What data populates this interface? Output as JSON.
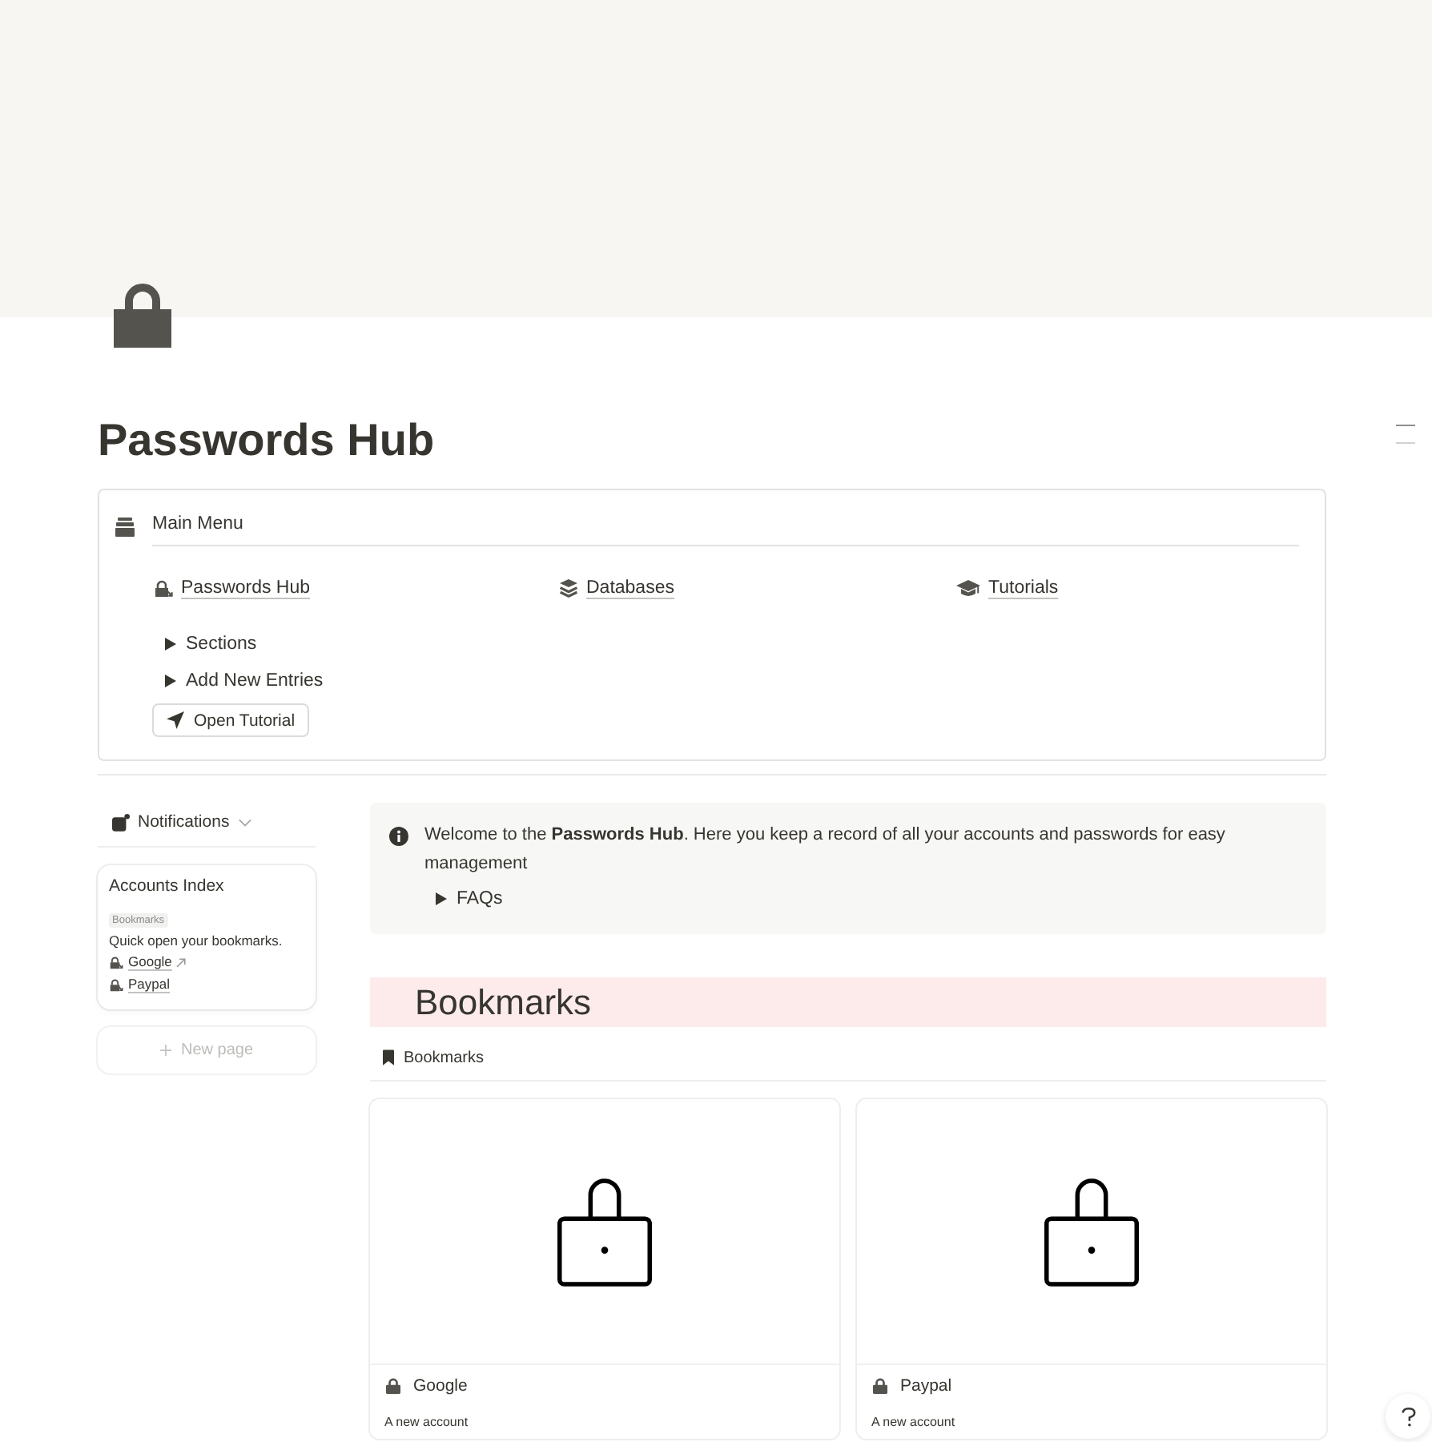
{
  "page": {
    "title": "Passwords Hub"
  },
  "main_menu": {
    "title": "Main Menu",
    "links": [
      {
        "label": "Passwords Hub"
      },
      {
        "label": "Databases"
      },
      {
        "label": "Tutorials"
      }
    ],
    "toggles": [
      {
        "label": "Sections",
        "expanded": false
      },
      {
        "label": "Add New Entries",
        "expanded": false
      }
    ],
    "button": {
      "label": "Open Tutorial"
    }
  },
  "sidebar": {
    "notifications": {
      "label": "Notifications"
    },
    "index_card": {
      "title": "Accounts Index",
      "tag": "Bookmarks",
      "description": "Quick open your bookmarks.",
      "links": [
        {
          "label": "Google",
          "external": true
        },
        {
          "label": "Paypal",
          "external": false
        }
      ]
    },
    "new_page": {
      "label": "New page"
    }
  },
  "callout": {
    "text": "Welcome to the **Passwords Hub**. Here you keep a record of all your accounts and passwords for easy management",
    "toggle": {
      "label": "FAQs",
      "expanded": false
    }
  },
  "heading": {
    "text": "Bookmarks"
  },
  "database": {
    "view": {
      "label": "Bookmarks"
    },
    "cards": [
      {
        "title": "Google",
        "description": "A new account"
      },
      {
        "title": "Paypal",
        "description": "A new account"
      }
    ]
  }
}
